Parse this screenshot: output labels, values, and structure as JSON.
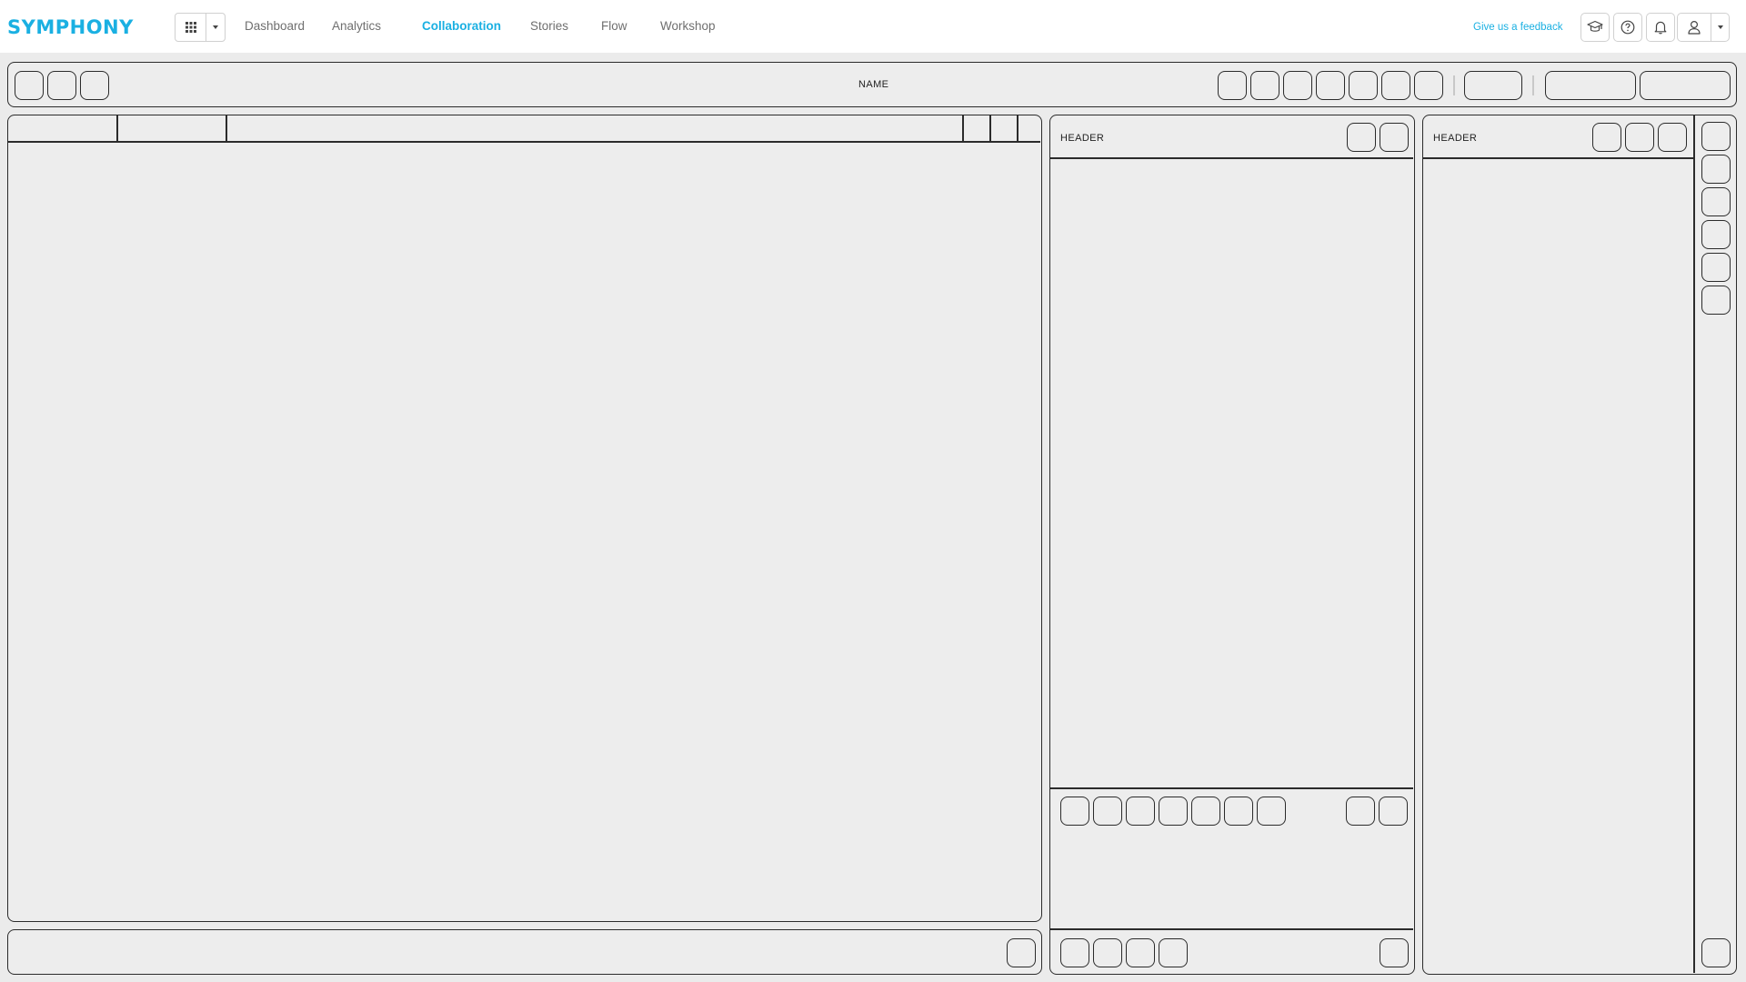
{
  "topbar": {
    "logo": "SYMPHONY",
    "app_switcher_icon": "grid-icon",
    "nav": [
      {
        "label": "Dashboard",
        "active": false
      },
      {
        "label": "Analytics",
        "active": false
      },
      {
        "label": "Collaboration",
        "active": true
      },
      {
        "label": "Stories",
        "active": false
      },
      {
        "label": "Flow",
        "active": false
      },
      {
        "label": "Workshop",
        "active": false
      }
    ],
    "feedback_link": "Give us a feedback",
    "icons": [
      "graduation-cap-icon",
      "help-icon",
      "bell-icon",
      "user-icon"
    ]
  },
  "toolbar": {
    "name_label": "NAME"
  },
  "panels": {
    "middle_header": "HEADER",
    "right_header": "HEADER"
  },
  "colors": {
    "accent": "#1ab0e2",
    "nav_text": "#6f6f6f",
    "background": "#ebebeb",
    "panel_fill": "#ededed",
    "wire_stroke": "#2b2b2b"
  }
}
